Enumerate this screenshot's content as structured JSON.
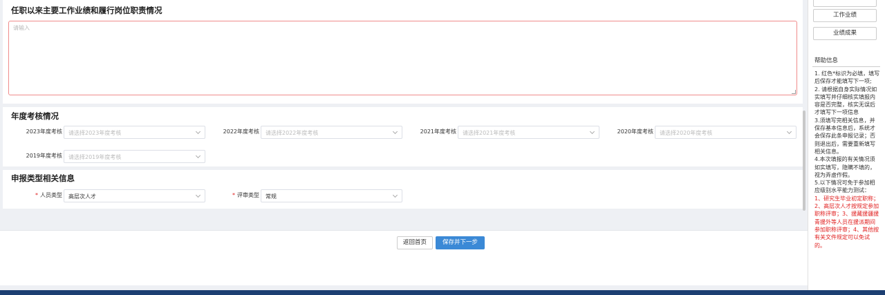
{
  "sections": {
    "work": {
      "title": "任职以来主要工作业绩和履行岗位职责情况",
      "placeholder": "请输入"
    },
    "annual": {
      "title": "年度考核情况",
      "fields": [
        {
          "label": "2023年度考核",
          "placeholder": "请选择2023年度考核"
        },
        {
          "label": "2022年度考核",
          "placeholder": "请选择2022年度考核"
        },
        {
          "label": "2021年度考核",
          "placeholder": "请选择2021年度考核"
        },
        {
          "label": "2020年度考核",
          "placeholder": "请选择2020年度考核"
        },
        {
          "label": "2019年度考核",
          "placeholder": "请选择2019年度考核"
        }
      ]
    },
    "type": {
      "title": "申报类型相关信息",
      "required_mark": "*",
      "person_type": {
        "label": "人员类型",
        "value": "高层次人才"
      },
      "review_type": {
        "label": "评审类型",
        "value": "常规"
      }
    }
  },
  "footer": {
    "home_label": "返回首页",
    "next_label": "保存并下一步"
  },
  "sidebar": {
    "nav": [
      "工作业绩",
      "业绩成果"
    ],
    "help_title": "帮助信息",
    "help_items": [
      "1. 红色*标识为必填，填写后保存才能填写下一项;",
      "2. 请根据自身实际情况如实填写并仔细核实填报内容是否完整，核实无误后才填写下一项信息",
      "3.须填写完相关信息，并保存基本信息后，系统才会保存此条申报记录；否则退出后，需要重新填写相关信息。",
      "4.本次填报的有关情况须如实填写，隐瞒不填的，视为弄虚作假。",
      "5.以下情况可免于参加相应级别水平能力测试："
    ],
    "help_red": "1、研究生毕业初定职称；2、高层次人才按规定参加职称评审；3、援藏援疆援青援外等人员在援派期间参加职称评审；4、其他按有关文件规定可以免试的。"
  },
  "colors": {
    "accent": "#3b89d6",
    "required": "#e02020",
    "bottom_bar": "#1c3f72"
  }
}
